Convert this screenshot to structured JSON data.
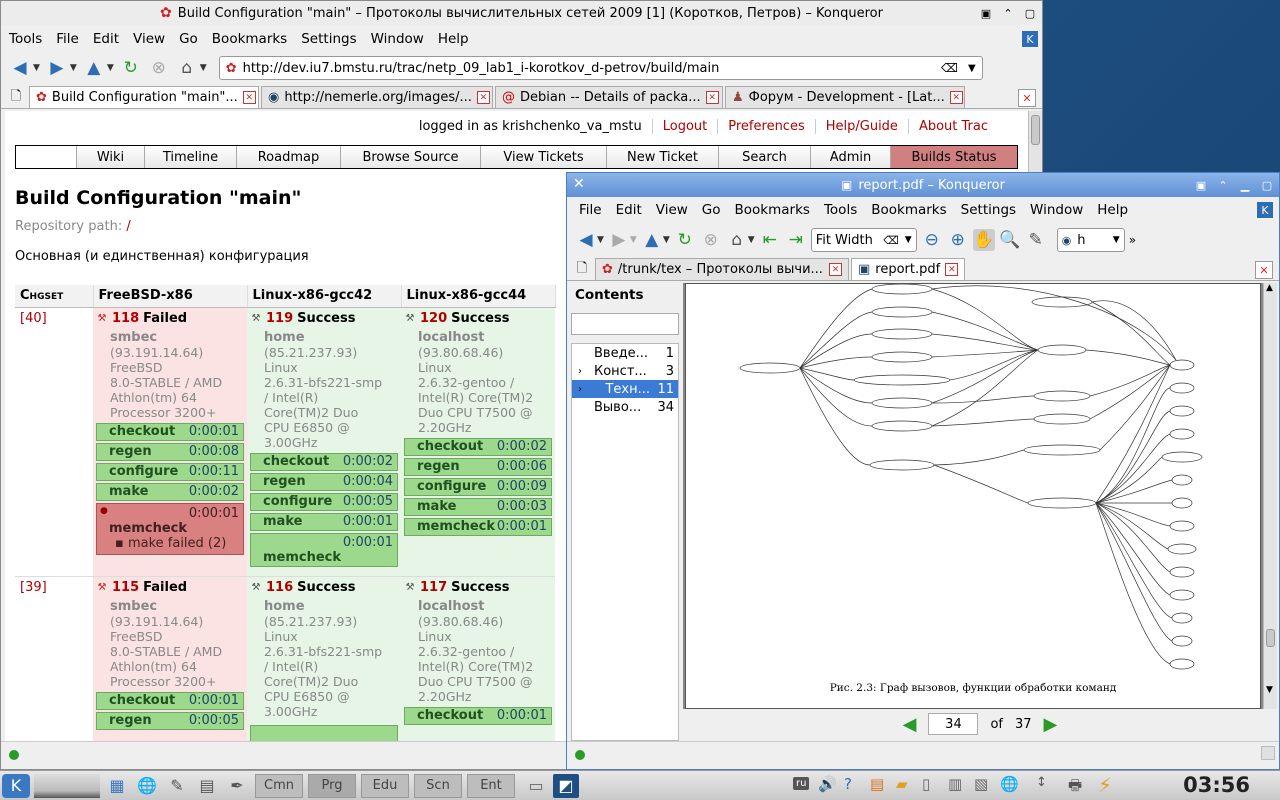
{
  "konq1": {
    "title": "Build Configuration \"main\" – Протоколы вычислительных сетей 2009 [1] (Коротков, Петров) – Konqueror",
    "menu": [
      "Tools",
      "File",
      "Edit",
      "View",
      "Go",
      "Bookmarks",
      "Settings",
      "Window",
      "Help"
    ],
    "url": "http://dev.iu7.bmstu.ru/trac/netp_09_lab1_i-korotkov_d-petrov/build/main",
    "tabs": [
      "Build Configuration \"main\"...",
      "http://nemerle.org/images/...",
      "Debian -- Details of packa...",
      "Форум - Development - [Lat..."
    ]
  },
  "trac": {
    "logged_in": "logged in as krishchenko_va_mstu",
    "meta_links": [
      "Logout",
      "Preferences",
      "Help/Guide",
      "About Trac"
    ],
    "nav": [
      "Wiki",
      "Timeline",
      "Roadmap",
      "Browse Source",
      "View Tickets",
      "New Ticket",
      "Search",
      "Admin",
      "Builds Status"
    ],
    "heading": "Build Configuration \"main\"",
    "repo_label": "Repository path:",
    "repo_path": "/",
    "description": "Основная (и единственная) конфигурация",
    "columns": [
      "Chgset",
      "FreeBSD-x86",
      "Linux-x86-gcc42",
      "Linux-x86-gcc44"
    ],
    "rows": [
      {
        "chgset": "[40]",
        "builds": [
          {
            "num": "118",
            "status": "Failed",
            "host": "smbec",
            "sys": "(93.191.14.64)\nFreeBSD\n8.0-STABLE / AMD\nAthlon(tm) 64\nProcessor 3200+",
            "steps": [
              [
                "checkout",
                "0:00:01"
              ],
              [
                "regen",
                "0:00:08"
              ],
              [
                "configure",
                "0:00:11"
              ],
              [
                "make",
                "0:00:02"
              ]
            ],
            "failstep": {
              "name": "memcheck",
              "time": "0:00:01",
              "msg": "make failed (2)"
            }
          },
          {
            "num": "119",
            "status": "Success",
            "host": "home",
            "sys": "(85.21.237.93)\nLinux\n2.6.31-bfs221-smp\n/ Intel(R)\nCore(TM)2 Duo\nCPU E6850 @\n3.00GHz",
            "steps": [
              [
                "checkout",
                "0:00:02"
              ],
              [
                "regen",
                "0:00:04"
              ],
              [
                "configure",
                "0:00:05"
              ],
              [
                "make",
                "0:00:01"
              ]
            ],
            "laststep": {
              "name": "memcheck",
              "time": "0:00:01"
            }
          },
          {
            "num": "120",
            "status": "Success",
            "host": "localhost",
            "sys": "(93.80.68.46)\nLinux\n2.6.32-gentoo /\nIntel(R) Core(TM)2\nDuo CPU T7500 @\n2.20GHz",
            "steps": [
              [
                "checkout",
                "0:00:02"
              ],
              [
                "regen",
                "0:00:06"
              ],
              [
                "configure",
                "0:00:09"
              ],
              [
                "make",
                "0:00:03"
              ],
              [
                "memcheck",
                "0:00:01"
              ]
            ]
          }
        ]
      },
      {
        "chgset": "[39]",
        "builds": [
          {
            "num": "115",
            "status": "Failed",
            "host": "smbec",
            "sys": "(93.191.14.64)\nFreeBSD\n8.0-STABLE / AMD\nAthlon(tm) 64\nProcessor 3200+",
            "steps": [
              [
                "checkout",
                "0:00:01"
              ],
              [
                "regen",
                "0:00:05"
              ]
            ]
          },
          {
            "num": "116",
            "status": "Success",
            "host": "home",
            "sys": "(85.21.237.93)\nLinux\n2.6.31-bfs221-smp\n/ Intel(R)\nCore(TM)2 Duo\nCPU E6850 @\n3.00GHz",
            "steps": []
          },
          {
            "num": "117",
            "status": "Success",
            "host": "localhost",
            "sys": "(93.80.68.46)\nLinux\n2.6.32-gentoo /\nIntel(R) Core(TM)2\nDuo CPU T7500 @\n2.20GHz",
            "steps": [
              [
                "checkout",
                "0:00:01"
              ]
            ]
          }
        ]
      }
    ]
  },
  "konq2": {
    "title": "report.pdf – Konqueror",
    "menu": [
      "File",
      "Edit",
      "View",
      "Go",
      "Bookmarks",
      "Tools",
      "Bookmarks",
      "Settings",
      "Window",
      "Help"
    ],
    "zoom": "Fit Width",
    "search": "h",
    "tabs": [
      "/trunk/tex – Протоколы вычи...",
      "report.pdf"
    ],
    "contents_title": "Contents",
    "toc": [
      {
        "label": "Введе...",
        "page": "1",
        "arrow": ""
      },
      {
        "label": "Конст...",
        "page": "3",
        "arrow": "›"
      },
      {
        "label": "Техн...",
        "page": "11",
        "arrow": "›",
        "selected": true
      },
      {
        "label": "Выво...",
        "page": "34",
        "arrow": ""
      }
    ],
    "caption": "Рис. 2.3: Граф вызовов, функции обработки команд",
    "page_current": "34",
    "page_of": "of",
    "page_total": "37"
  },
  "taskbar": {
    "pagers": [
      "Cmn",
      "Prg",
      "Edu",
      "Scn",
      "Ent"
    ],
    "tray": "ru",
    "clock": "03:56"
  }
}
